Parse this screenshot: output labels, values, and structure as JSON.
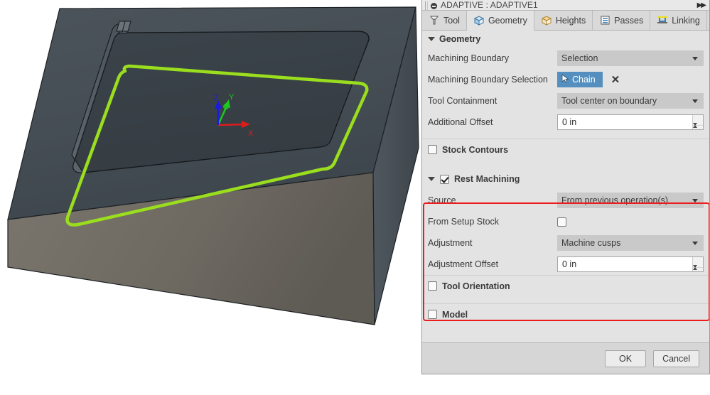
{
  "dialog": {
    "title": "ADAPTIVE : ADAPTIVE1",
    "expand_icon": "fast-forward-icon",
    "tabs": [
      {
        "label": "Tool",
        "icon": "tool-icon",
        "active": false
      },
      {
        "label": "Geometry",
        "icon": "geometry-icon",
        "active": true
      },
      {
        "label": "Heights",
        "icon": "heights-icon",
        "active": false
      },
      {
        "label": "Passes",
        "icon": "passes-icon",
        "active": false
      },
      {
        "label": "Linking",
        "icon": "linking-icon",
        "active": false
      }
    ],
    "geometry_group": {
      "title": "Geometry",
      "machining_boundary": {
        "label": "Machining Boundary",
        "value": "Selection"
      },
      "machining_boundary_selection": {
        "label": "Machining Boundary Selection",
        "button": "Chain",
        "button_icon": "cursor-arrow-icon",
        "clear_icon": "close-x-icon"
      },
      "tool_containment": {
        "label": "Tool Containment",
        "value": "Tool center on boundary"
      },
      "additional_offset": {
        "label": "Additional Offset",
        "value": "0 in"
      }
    },
    "stock_contours": {
      "label": "Stock Contours",
      "checked": false
    },
    "rest_machining": {
      "label": "Rest Machining",
      "checked": true,
      "highlighted": true,
      "source": {
        "label": "Source",
        "value": "From previous operation(s)"
      },
      "from_setup_stock": {
        "label": "From Setup Stock",
        "checked": false
      },
      "adjustment": {
        "label": "Adjustment",
        "value": "Machine cusps"
      },
      "adjustment_offset": {
        "label": "Adjustment Offset",
        "value": "0 in"
      }
    },
    "tool_orientation": {
      "label": "Tool Orientation",
      "checked": false
    },
    "model": {
      "label": "Model",
      "checked": false
    },
    "footer": {
      "ok": "OK",
      "cancel": "Cancel"
    },
    "colors": {
      "panel_bg": "#e3e3e3",
      "dropdown_bg": "#c9c9c9",
      "accent_blue": "#558fbf",
      "highlight_red": "#ee1b1b"
    }
  },
  "viewport": {
    "name": "3d-cam-viewport",
    "toolpath_boundary_color": "#9ade1e",
    "stock_top_color": "#414a50",
    "stock_side_color": "#6e6a63",
    "axes": [
      {
        "name": "x-axis",
        "label": "X",
        "color": "#e01b1b"
      },
      {
        "name": "y-axis",
        "label": "Y",
        "color": "#1ec81e"
      },
      {
        "name": "z-axis",
        "label": "Z",
        "color": "#1b1be0"
      }
    ]
  }
}
